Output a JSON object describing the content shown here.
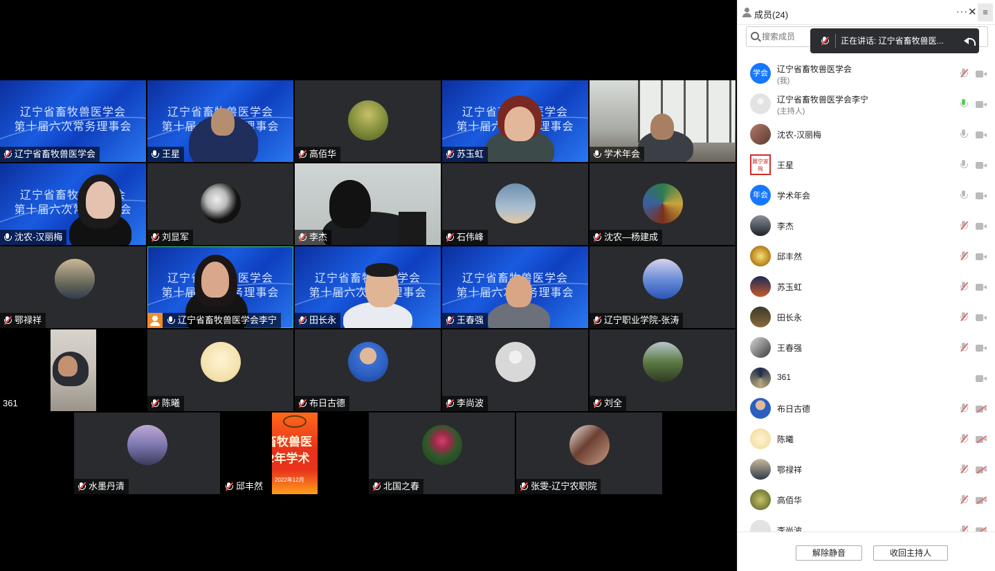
{
  "panel": {
    "title": "成员(24)",
    "more": "···",
    "close": "✕",
    "menu": "≡",
    "search_placeholder": "搜索成员",
    "speaking_text": "正在讲话: 辽宁省畜牧兽医...",
    "unmute_label": "解除静音",
    "reclaim_host_label": "收回主持人"
  },
  "banner": {
    "line1": "辽宁省畜牧兽医学会",
    "line2": "第十届六次常务理事会"
  },
  "tiles": {
    "t1": "辽宁省畜牧兽医学会",
    "t2": "王星",
    "t3": "高佰华",
    "t4": "苏玉虹",
    "t5": "学术年会",
    "t6": "沈农-汉丽梅",
    "t7": "刘显军",
    "t8": "李杰",
    "t9": "石伟峰",
    "t10": "沈农—杨建成",
    "t11": "鄂禄祥",
    "t12": "辽宁省畜牧兽医学会李宁",
    "t13": "田长永",
    "t14": "王春强",
    "t15": "辽宁职业学院-张涛",
    "t16": "361",
    "t17": "陈曦",
    "t18": "布日古德",
    "t19": "李尚波",
    "t20": "刘全",
    "t21": "水墨丹清",
    "t22": "邱丰然",
    "t23": "北国之春",
    "t24": "张雯-辽宁农职院"
  },
  "poster": {
    "line1": "畜牧兽医",
    "line2": "2年学术",
    "date": "2022年12月"
  },
  "members": [
    {
      "name": "辽宁省畜牧兽医学会",
      "sub": "(我)",
      "avatar_text": "学会",
      "avatar_color": "#1677ff"
    },
    {
      "name": "辽宁省畜牧兽医学会李宁",
      "sub": "(主持人)"
    },
    {
      "name": "沈农-汉丽梅"
    },
    {
      "name": "王星",
      "avatar_text": "翼宁家殉"
    },
    {
      "name": "学术年会",
      "avatar_text": "年会",
      "avatar_color": "#1677ff"
    },
    {
      "name": "李杰"
    },
    {
      "name": "邱丰然"
    },
    {
      "name": "苏玉虹"
    },
    {
      "name": "田长永"
    },
    {
      "name": "王春强"
    },
    {
      "name": "361"
    },
    {
      "name": "布日古德"
    },
    {
      "name": "陈曦"
    },
    {
      "name": "鄂禄祥"
    },
    {
      "name": "高佰华"
    },
    {
      "name": "李尚波"
    }
  ],
  "colors": {
    "speaking_green": "#5ac85a",
    "muted_red": "#e86a6a",
    "host_badge": "#f28c28",
    "active_border": "#3fd07a"
  }
}
